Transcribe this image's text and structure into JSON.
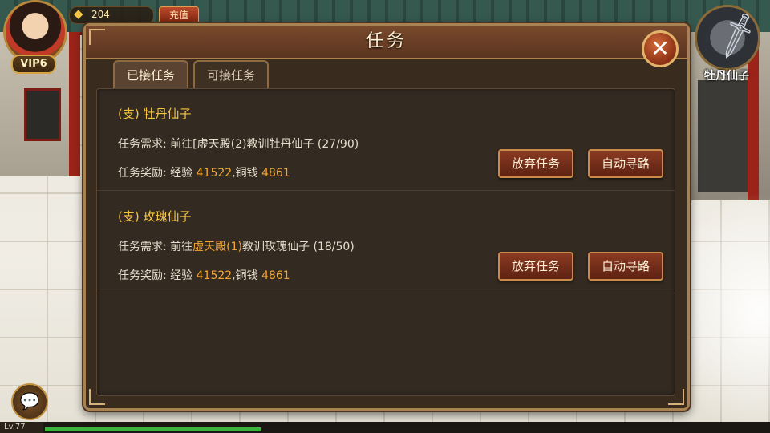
{
  "hud": {
    "vip": "VIP6",
    "gold_amount": "204",
    "recharge_label": "充值",
    "target_name": "牡丹仙子",
    "level_label": "Lv.77",
    "exp_fraction": 0.3
  },
  "dialog": {
    "title": "任务",
    "close_label": "✕",
    "tabs": [
      {
        "label": "已接任务",
        "active": true
      },
      {
        "label": "可接任务",
        "active": false
      }
    ],
    "tasks": [
      {
        "name": "(支) 牡丹仙子",
        "req_prefix": "任务需求: 前往",
        "req_location": "[虚天殿(2)",
        "req_suffix": "教训牡丹仙子 (27/90)",
        "reward_prefix": "任务奖励: 经验 ",
        "reward_exp": "41522",
        "reward_mid": ",铜钱 ",
        "reward_coins": "4861",
        "abandon_label": "放弃任务",
        "auto_label": "自动寻路"
      },
      {
        "name": "(支) 玫瑰仙子",
        "req_prefix": "任务需求: 前往",
        "req_location": "虚天殿(1)",
        "req_suffix": "教训玫瑰仙子 (18/50)",
        "reward_prefix": "任务奖励: 经验 ",
        "reward_exp": "41522",
        "reward_mid": ",铜钱 ",
        "reward_coins": "4861",
        "abandon_label": "放弃任务",
        "auto_label": "自动寻路"
      }
    ]
  },
  "colors": {
    "task_name": "#f5c542",
    "highlight": "#f2a633",
    "panel_bg": "#332a22"
  }
}
